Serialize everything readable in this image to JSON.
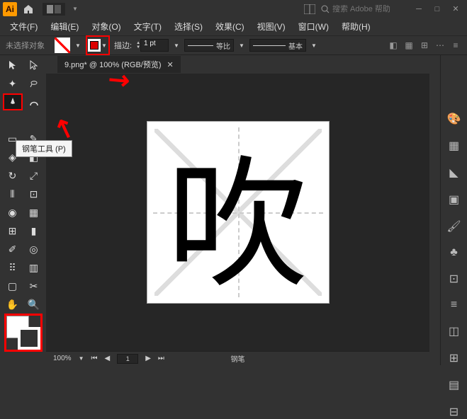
{
  "app": {
    "name": "Ai",
    "search_placeholder": "搜索 Adobe 帮助"
  },
  "menu": {
    "file": "文件(F)",
    "edit": "编辑(E)",
    "object": "对象(O)",
    "type": "文字(T)",
    "select": "选择(S)",
    "effect": "效果(C)",
    "view": "视图(V)",
    "window": "窗口(W)",
    "help": "帮助(H)"
  },
  "ctrl": {
    "no_selection": "未选择对象",
    "stroke_label": "描边:",
    "stroke_weight": "1 pt",
    "profile_uniform": "等比",
    "brush_basic": "基本"
  },
  "tab": {
    "title": "9.png* @ 100% (RGB/预览)"
  },
  "tooltip": {
    "pen": "钢笔工具 (P)"
  },
  "canvas": {
    "glyph": "吹"
  },
  "status": {
    "zoom": "100%",
    "page": "1",
    "tool": "钢笔"
  }
}
